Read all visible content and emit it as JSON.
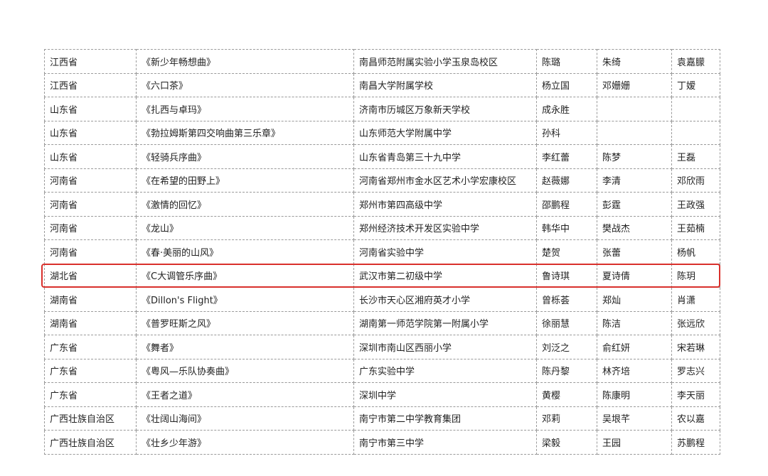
{
  "highlight_color": "#d9302c",
  "rows": [
    [
      "江西省",
      "《新少年畅想曲》",
      "南昌师范附属实验小学玉泉岛校区",
      "陈璐",
      "朱绮",
      "袁嘉朦"
    ],
    [
      "江西省",
      "《六口茶》",
      "南昌大学附属学校",
      "杨立国",
      "邓姗姗",
      "丁嫒"
    ],
    [
      "山东省",
      "《扎西与卓玛》",
      "济南市历城区万象新天学校",
      "成永胜",
      "",
      ""
    ],
    [
      "山东省",
      "《勃拉姆斯第四交响曲第三乐章》",
      "山东师范大学附属中学",
      "孙科",
      "",
      ""
    ],
    [
      "山东省",
      "《轻骑兵序曲》",
      "山东省青岛第三十九中学",
      "李红蕾",
      "陈梦",
      "王磊"
    ],
    [
      "河南省",
      "《在希望的田野上》",
      "河南省郑州市金水区艺术小学宏康校区",
      "赵薇娜",
      "李清",
      "邓欣雨"
    ],
    [
      "河南省",
      "《激情的回忆》",
      "郑州市第四高级中学",
      "邵鹏程",
      "彭霆",
      "王政强"
    ],
    [
      "河南省",
      "《龙山》",
      "郑州经济技术开发区实验中学",
      "韩华中",
      "樊战杰",
      "王茹楠"
    ],
    [
      "河南省",
      "《春·美丽的山风》",
      "河南省实验中学",
      "楚贺",
      "张蕾",
      "杨帆"
    ],
    [
      "湖北省",
      "《C大调管乐序曲》",
      "武汉市第二初级中学",
      "鲁诗琪",
      "夏诗倩",
      "陈玥"
    ],
    [
      "湖南省",
      "《Dillon's Flight》",
      "长沙市天心区湘府英才小学",
      "曾栎荟",
      "郑灿",
      "肖潇"
    ],
    [
      "湖南省",
      "《普罗旺斯之风》",
      "湖南第一师范学院第一附属小学",
      "徐丽慧",
      "陈洁",
      "张远欣"
    ],
    [
      "广东省",
      "《舞者》",
      "深圳市南山区西丽小学",
      "刘泛之",
      "俞红妍",
      "宋若琳"
    ],
    [
      "广东省",
      "《粤风—乐队协奏曲》",
      "广东实验中学",
      "陈丹黎",
      "林齐培",
      "罗志兴"
    ],
    [
      "广东省",
      "《王者之道》",
      "深圳中学",
      "黄樱",
      "陈康明",
      "李天丽"
    ],
    [
      "广西壮族自治区",
      "《壮阔山海间》",
      "南宁市第二中学教育集团",
      "邓莉",
      "吴垠芊",
      "农以嘉"
    ],
    [
      "广西壮族自治区",
      "《壮乡少年游》",
      "南宁市第三中学",
      "梁毅",
      "王园",
      "苏鹏程"
    ]
  ]
}
